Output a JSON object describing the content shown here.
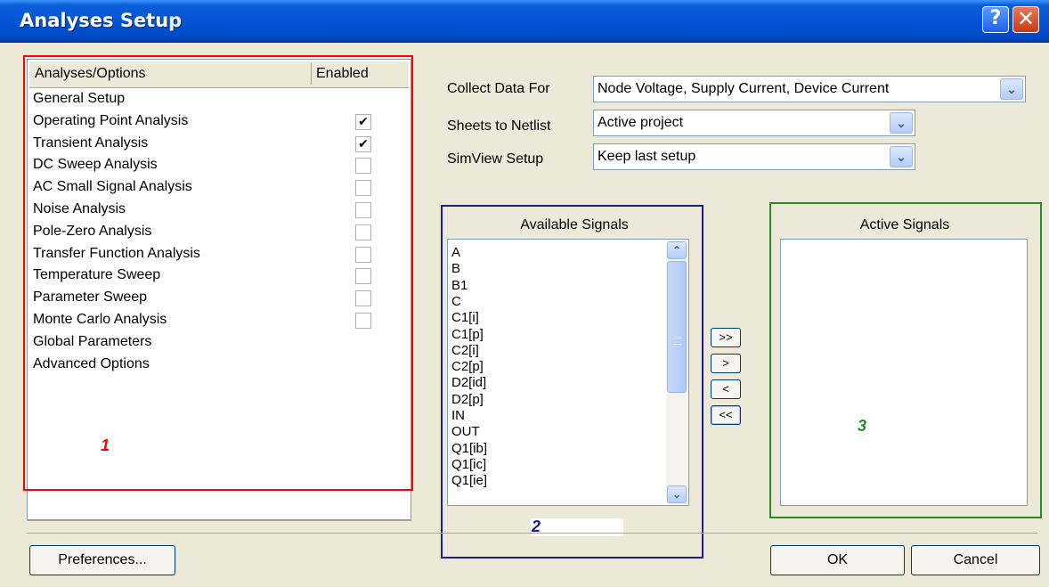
{
  "window": {
    "title": "Analyses Setup",
    "help_glyph": "?",
    "close_glyph": "✕"
  },
  "analyses_panel": {
    "header": {
      "col1": "Analyses/Options",
      "col2": "Enabled"
    },
    "items": [
      {
        "label": "General Setup",
        "checkbox": false,
        "checked": false
      },
      {
        "label": "Operating Point Analysis",
        "checkbox": true,
        "checked": true
      },
      {
        "label": "Transient Analysis",
        "checkbox": true,
        "checked": true
      },
      {
        "label": "DC Sweep Analysis",
        "checkbox": true,
        "checked": false
      },
      {
        "label": "AC Small Signal Analysis",
        "checkbox": true,
        "checked": false
      },
      {
        "label": "Noise Analysis",
        "checkbox": true,
        "checked": false
      },
      {
        "label": "Pole-Zero Analysis",
        "checkbox": true,
        "checked": false
      },
      {
        "label": "Transfer Function Analysis",
        "checkbox": true,
        "checked": false
      },
      {
        "label": "Temperature Sweep",
        "checkbox": true,
        "checked": false
      },
      {
        "label": "Parameter Sweep",
        "checkbox": true,
        "checked": false
      },
      {
        "label": "Monte Carlo Analysis",
        "checkbox": true,
        "checked": false
      },
      {
        "label": "Global Parameters",
        "checkbox": false,
        "checked": false
      },
      {
        "label": "Advanced Options",
        "checkbox": false,
        "checked": false
      }
    ]
  },
  "fields": {
    "collect_data_for": {
      "label": "Collect Data For",
      "value": "Node Voltage, Supply Current, Device Current"
    },
    "sheets_to_netlist": {
      "label": "Sheets to Netlist",
      "value": "Active project"
    },
    "simview_setup": {
      "label": "SimView Setup",
      "value": "Keep last setup"
    }
  },
  "available_signals": {
    "title": "Available Signals",
    "items": [
      "A",
      "B",
      "B1",
      "C",
      "C1[i]",
      "C1[p]",
      "C2[i]",
      "C2[p]",
      "D2[id]",
      "D2[p]",
      "IN",
      "OUT",
      "Q1[ib]",
      "Q1[ic]",
      "Q1[ie]"
    ]
  },
  "active_signals": {
    "title": "Active Signals",
    "items": []
  },
  "move_buttons": {
    "add_all": ">>",
    "add": ">",
    "remove": "<",
    "remove_all": "<<"
  },
  "annotations": {
    "region1": "1",
    "region2": "2",
    "region3": "3"
  },
  "annotation_colors": {
    "region1": "#ff0000",
    "region2": "#1c1c8c",
    "region3": "#2a8a2a"
  },
  "buttons": {
    "preferences": "Preferences...",
    "ok": "OK",
    "cancel": "Cancel"
  },
  "icons": {
    "dropdown": "chevron-down-icon",
    "scroll_up": "arrow-up-icon",
    "scroll_down": "arrow-down-icon",
    "check": "check-icon"
  }
}
